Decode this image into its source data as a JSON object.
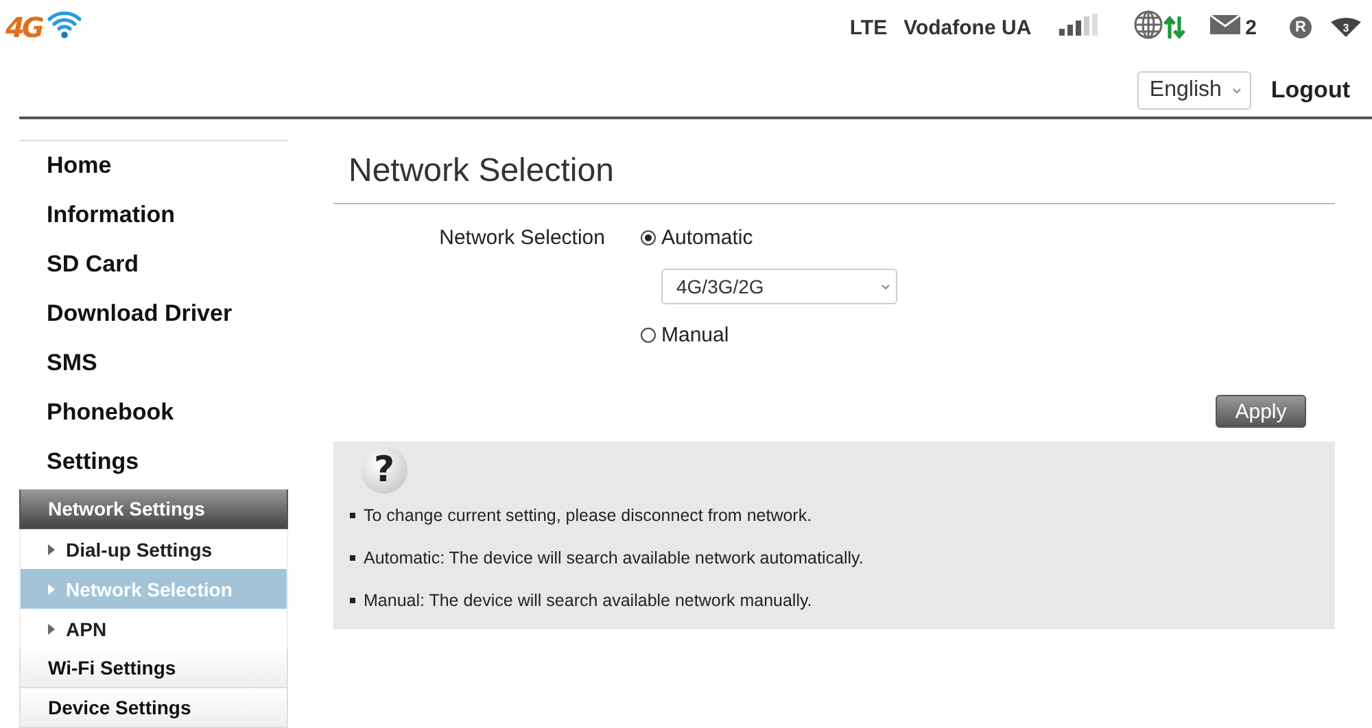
{
  "header": {
    "logo": "4G",
    "network_type": "LTE",
    "operator": "Vodafone UA",
    "messages": "2",
    "roaming": "R",
    "wifi_clients": "3",
    "language": "English",
    "logout": "Logout"
  },
  "sidebar": [
    {
      "label": "Home",
      "kind": "main"
    },
    {
      "label": "Information",
      "kind": "main"
    },
    {
      "label": "SD Card",
      "kind": "main"
    },
    {
      "label": "Download Driver",
      "kind": "main"
    },
    {
      "label": "SMS",
      "kind": "main"
    },
    {
      "label": "Phonebook",
      "kind": "main"
    },
    {
      "label": "Settings",
      "kind": "main"
    },
    {
      "label": "Network Settings",
      "kind": "section",
      "expanded": true,
      "children": [
        {
          "label": "Dial-up Settings",
          "selected": false
        },
        {
          "label": "Network Selection",
          "selected": true
        },
        {
          "label": "APN",
          "selected": false
        }
      ]
    },
    {
      "label": "Wi-Fi Settings",
      "kind": "section",
      "expanded": false
    },
    {
      "label": "Device Settings",
      "kind": "section",
      "expanded": false
    }
  ],
  "main": {
    "title": "Network Selection",
    "field_label": "Network Selection",
    "options": [
      {
        "label": "Automatic",
        "selected": true
      },
      {
        "label": "Manual",
        "selected": false
      }
    ],
    "mode": "4G/3G/2G",
    "apply": "Apply",
    "help_icon": "?",
    "help": [
      "To change current setting, please disconnect from network.",
      "Automatic: The device will search available network automatically.",
      "Manual: The device will search available network manually."
    ]
  }
}
